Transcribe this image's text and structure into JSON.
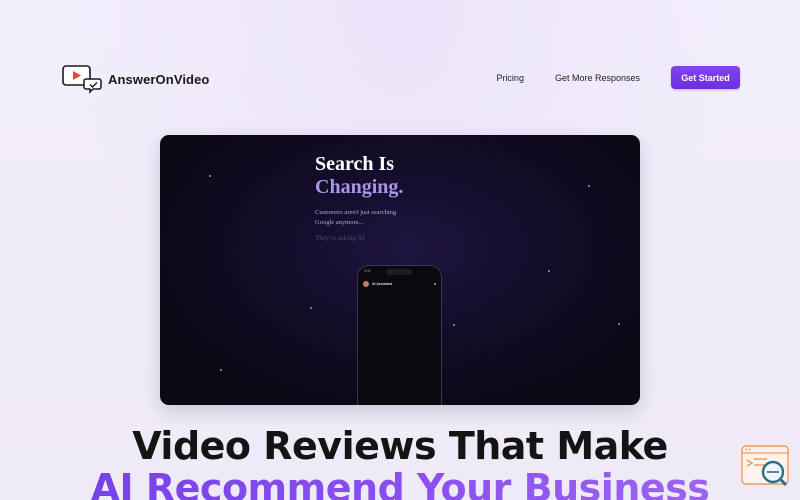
{
  "brand": {
    "name": "AnswerOnVideo",
    "icon": "video-chat-logo-icon"
  },
  "nav": {
    "links": [
      "Pricing",
      "Get More Responses"
    ],
    "cta": "Get Started"
  },
  "hero_video": {
    "title_line1": "Search Is",
    "title_line2": "Changing.",
    "sub_line1": "Customers aren't just searching",
    "sub_line2": "Google anymore...",
    "sub_line3": "They're asking AI",
    "phone": {
      "time": "9:41",
      "chat_name": "AI Assistant"
    }
  },
  "headline": {
    "line1": "Video Reviews That Make",
    "line2": "AI Recommend Your Business"
  },
  "floating_widget": {
    "icon": "search-analytics-icon"
  },
  "colors": {
    "accent": "#7a3ef0",
    "accent_light": "#a995e6",
    "hero_bg": "#0c0816"
  }
}
